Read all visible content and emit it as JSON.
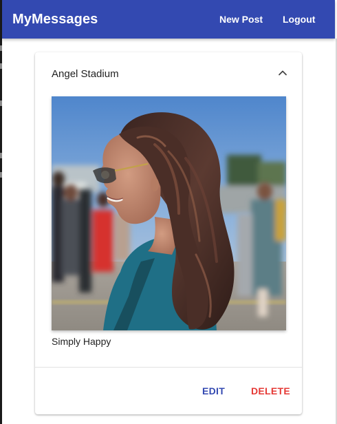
{
  "appbar": {
    "title": "MyMessages",
    "new_post_label": "New Post",
    "logout_label": "Logout",
    "background_color": "#3349b1"
  },
  "post": {
    "title": "Angel Stadium",
    "collapse_icon": "chevron-up-icon",
    "caption": "Simply Happy",
    "image_subject": "smiling woman in profile with long wavy brown hair, sunglasses, teal top, blurred outdoor crowd background",
    "actions": {
      "edit_label": "EDIT",
      "delete_label": "DELETE",
      "edit_color": "#3349b1",
      "delete_color": "#e53935"
    }
  }
}
